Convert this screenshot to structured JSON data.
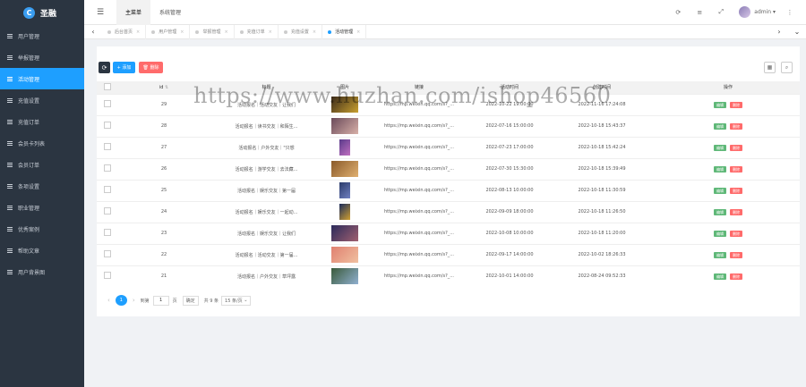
{
  "brand": {
    "name": "圣融",
    "logo_letter": "C"
  },
  "sidebar": {
    "items": [
      {
        "label": "用户管理",
        "active": false
      },
      {
        "label": "举报管理",
        "active": false
      },
      {
        "label": "活动管理",
        "active": true
      },
      {
        "label": "充值设置",
        "active": false
      },
      {
        "label": "充值订单",
        "active": false
      },
      {
        "label": "会员卡列表",
        "active": false
      },
      {
        "label": "会员订单",
        "active": false
      },
      {
        "label": "条项设置",
        "active": false
      },
      {
        "label": "职业管理",
        "active": false
      },
      {
        "label": "优秀案例",
        "active": false
      },
      {
        "label": "帮助文章",
        "active": false
      },
      {
        "label": "用户背景图",
        "active": false
      }
    ]
  },
  "topbar": {
    "menu_tabs": [
      {
        "label": "主菜单",
        "active": true
      },
      {
        "label": "系统管理",
        "active": false
      }
    ],
    "icons": [
      "refresh-icon",
      "menu-icon",
      "fullscreen-icon"
    ],
    "user": "admin"
  },
  "tabs": [
    {
      "label": "后台首页",
      "active": false
    },
    {
      "label": "用户管理",
      "active": false
    },
    {
      "label": "举报管理",
      "active": false
    },
    {
      "label": "充值订单",
      "active": false
    },
    {
      "label": "充值设置",
      "active": false
    },
    {
      "label": "活动管理",
      "active": true
    }
  ],
  "toolbar": {
    "add_label": "添加",
    "delete_label": "删除"
  },
  "table": {
    "columns": [
      "",
      "id",
      "标题",
      "图片",
      "链接",
      "活动时间",
      "创建时间",
      "操作"
    ],
    "rows": [
      {
        "id": "29",
        "title": "活动报名｜活动交友｜让我们",
        "link": "https://mp.weixin.qq.com/s?_...",
        "activity_time": "2022-10-22 19:00:00",
        "created": "2022-11-16 17:24:08",
        "img": "#3a2a1a,#c9a030",
        "narrow": false
      },
      {
        "id": "28",
        "title": "活动报名｜读书交友｜和陌生...",
        "link": "https://mp.weixin.qq.com/s?_...",
        "activity_time": "2022-07-16 15:00:00",
        "created": "2022-10-18 15:43:37",
        "img": "#6a4a5a,#d8b0a8",
        "narrow": false
      },
      {
        "id": "27",
        "title": "活动报名｜户外交友｜\"只想",
        "link": "https://mp.weixin.qq.com/s?_...",
        "activity_time": "2022-07-23 17:00:00",
        "created": "2022-10-18 15:42:24",
        "img": "#5a3a8a,#c070c0",
        "narrow": true
      },
      {
        "id": "26",
        "title": "活动报名｜游学交友｜去法藏...",
        "link": "https://mp.weixin.qq.com/s?_...",
        "activity_time": "2022-07-30 15:30:00",
        "created": "2022-10-18 15:39:49",
        "img": "#8a5a2a,#e0b070",
        "narrow": false
      },
      {
        "id": "25",
        "title": "活动报名｜娱乐交友｜第一届",
        "link": "https://mp.weixin.qq.com/s?_...",
        "activity_time": "2022-08-13 10:00:00",
        "created": "2022-10-18 11:30:59",
        "img": "#2a3a6a,#7080c0",
        "narrow": true
      },
      {
        "id": "24",
        "title": "活动报名｜娱乐交友｜一起动...",
        "link": "https://mp.weixin.qq.com/s?_...",
        "activity_time": "2022-09-09 18:00:00",
        "created": "2022-10-18 11:26:50",
        "img": "#1a2a5a,#d0a030",
        "narrow": true
      },
      {
        "id": "23",
        "title": "活动报名｜娱乐交友｜让我们",
        "link": "https://mp.weixin.qq.com/s?_...",
        "activity_time": "2022-10-08 10:00:00",
        "created": "2022-10-18 11:20:00",
        "img": "#2a2a5a,#a06070",
        "narrow": false
      },
      {
        "id": "22",
        "title": "活动报名｜活动交友｜第一届...",
        "link": "https://mp.weixin.qq.com/s?_...",
        "activity_time": "2022-09-17 14:00:00",
        "created": "2022-10-02 18:26:33",
        "img": "#e08070,#f0c0a0",
        "narrow": false
      },
      {
        "id": "21",
        "title": "活动报名｜户外交友｜草坪露",
        "link": "https://mp.weixin.qq.com/s?_...",
        "activity_time": "2022-10-01 14:00:00",
        "created": "2022-08-24 09:52:33",
        "img": "#3a5a3a,#90b0d0",
        "narrow": false
      }
    ],
    "edit_label": "编辑",
    "delete_label": "删除"
  },
  "pagination": {
    "current_page": "1",
    "goto_label": "到第",
    "page_unit": "页",
    "confirm_label": "确定",
    "total": "共 9 条",
    "per_page": "15 条/页"
  },
  "watermark": "https://www.huzhan.com/ishop46560"
}
